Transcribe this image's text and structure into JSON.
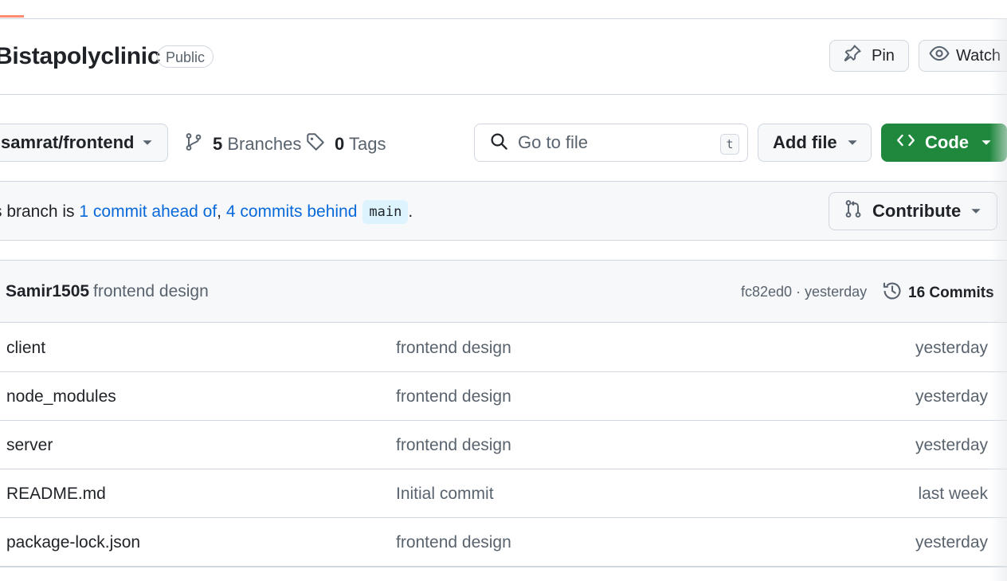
{
  "repo": {
    "name": "Bistapolyclinic",
    "visibility": "Public"
  },
  "actions": {
    "pin_label": "Pin",
    "watch_label": "Watch"
  },
  "toolbar": {
    "branch": "samrat/frontend",
    "branches_count": "5",
    "branches_label": "Branches",
    "tags_count": "0",
    "tags_label": "Tags",
    "search_placeholder": "Go to file",
    "search_shortcut": "t",
    "add_file_label": "Add file",
    "code_label": "Code"
  },
  "branch_status": {
    "prefix": "s branch is ",
    "ahead_link": "1 commit ahead of",
    "separator": ", ",
    "behind_link": "4 commits behind",
    "base_branch": "main",
    "suffix": ".",
    "contribute_label": "Contribute"
  },
  "latest_commit": {
    "author": "Samir1505",
    "message": "frontend design",
    "meta": "fc82ed0 · yesterday",
    "commits_label": "16 Commits"
  },
  "files": [
    {
      "name": "client",
      "message": "frontend design",
      "time": "yesterday"
    },
    {
      "name": "node_modules",
      "message": "frontend design",
      "time": "yesterday"
    },
    {
      "name": "server",
      "message": "frontend design",
      "time": "yesterday"
    },
    {
      "name": "README.md",
      "message": "Initial commit",
      "time": "last week"
    },
    {
      "name": "package-lock.json",
      "message": "frontend design",
      "time": "yesterday"
    }
  ],
  "colors": {
    "link": "#0969da",
    "code_button": "#1f883d",
    "border": "#d0d7de",
    "muted_text": "#59636e",
    "active_tab_underline": "#fd8c73"
  },
  "icons": [
    "pin-icon",
    "eye-icon",
    "branch-icon",
    "tag-icon",
    "search-icon",
    "code-icon",
    "pull-request-icon",
    "history-icon",
    "chevron-down-icon"
  ]
}
